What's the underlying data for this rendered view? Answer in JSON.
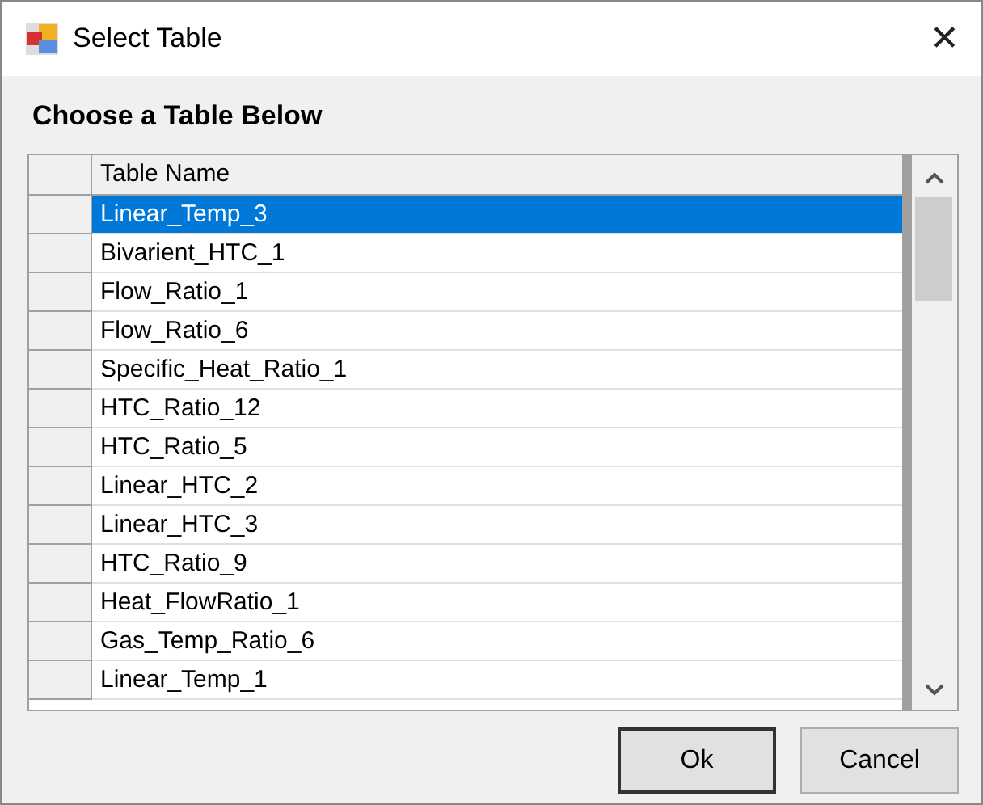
{
  "window": {
    "title": "Select Table",
    "close": "✕"
  },
  "heading": "Choose a Table Below",
  "table": {
    "columns": [
      "Table Name"
    ],
    "rows": [
      {
        "name": "Linear_Temp_3",
        "selected": true
      },
      {
        "name": "Bivarient_HTC_1",
        "selected": false
      },
      {
        "name": "Flow_Ratio_1",
        "selected": false
      },
      {
        "name": "Flow_Ratio_6",
        "selected": false
      },
      {
        "name": "Specific_Heat_Ratio_1",
        "selected": false
      },
      {
        "name": "HTC_Ratio_12",
        "selected": false
      },
      {
        "name": "HTC_Ratio_5",
        "selected": false
      },
      {
        "name": "Linear_HTC_2",
        "selected": false
      },
      {
        "name": "Linear_HTC_3",
        "selected": false
      },
      {
        "name": "HTC_Ratio_9",
        "selected": false
      },
      {
        "name": "Heat_FlowRatio_1",
        "selected": false
      },
      {
        "name": "Gas_Temp_Ratio_6",
        "selected": false
      },
      {
        "name": "Linear_Temp_1",
        "selected": false
      }
    ]
  },
  "buttons": [
    {
      "label": "Ok",
      "default": true
    },
    {
      "label": "Cancel",
      "default": false
    }
  ]
}
